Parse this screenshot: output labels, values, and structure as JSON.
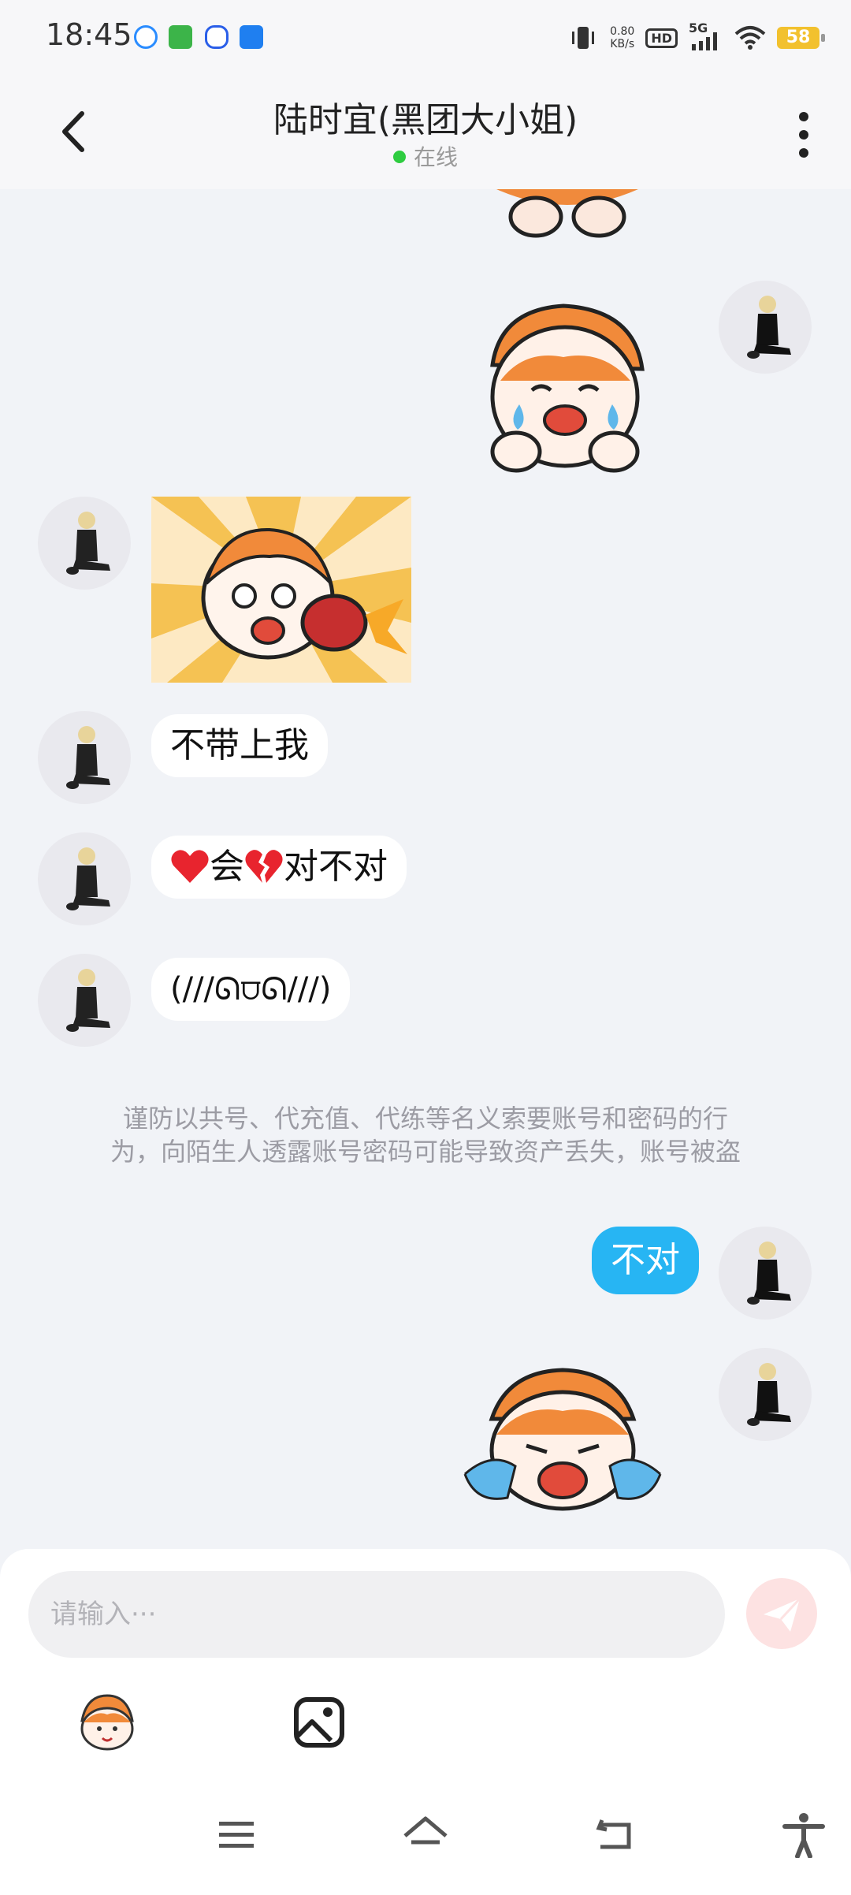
{
  "status_bar": {
    "time": "18:45",
    "net_speed_value": "0.80",
    "net_speed_unit": "KB/s",
    "hd_label": "HD",
    "signal_label": "5G",
    "battery": "58"
  },
  "header": {
    "title": "陆时宜(黑团大小姐)",
    "status": "在线"
  },
  "messages": {
    "m4_text": "不带上我",
    "m5_part1": "会",
    "m5_part2": "对不对",
    "m6_text": "(///ᘏ⩌ᘏ///)",
    "m7_text": "不对"
  },
  "notice": {
    "line1": "谨防以共号、代充值、代练等名义索要账号和密码的行",
    "line2": "为，向陌生人透露账号密码可能导致资产丢失，账号被盗"
  },
  "input": {
    "placeholder": "请输入···"
  },
  "colors": {
    "my_bubble": "#27b5f3",
    "online_dot": "#2ecc40",
    "page_bg": "#f1f3f7"
  }
}
